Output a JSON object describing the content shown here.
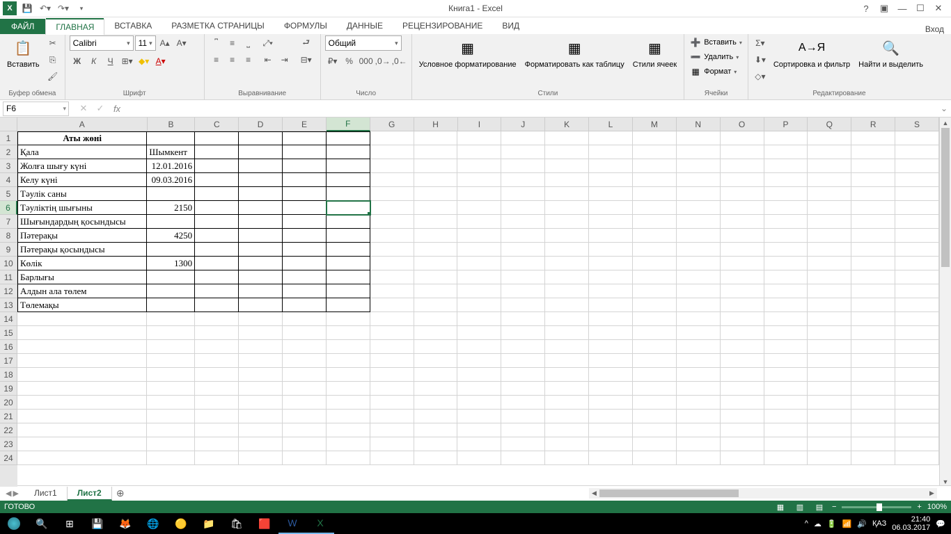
{
  "titlebar": {
    "title": "Книга1 - Excel"
  },
  "tabs": {
    "file": "ФАЙЛ",
    "items": [
      "ГЛАВНАЯ",
      "ВСТАВКА",
      "РАЗМЕТКА СТРАНИЦЫ",
      "ФОРМУЛЫ",
      "ДАННЫЕ",
      "РЕЦЕНЗИРОВАНИЕ",
      "ВИД"
    ],
    "active": 0,
    "signin": "Вход"
  },
  "ribbon": {
    "clipboard": {
      "paste": "Вставить",
      "label": "Буфер обмена"
    },
    "font": {
      "name": "Calibri",
      "size": "11",
      "label": "Шрифт"
    },
    "alignment": {
      "label": "Выравнивание"
    },
    "number": {
      "format": "Общий",
      "label": "Число"
    },
    "styles": {
      "cond": "Условное форматирование",
      "table": "Форматировать как таблицу",
      "cell": "Стили ячеек",
      "label": "Стили"
    },
    "cells": {
      "insert": "Вставить",
      "delete": "Удалить",
      "format": "Формат",
      "label": "Ячейки"
    },
    "editing": {
      "sort": "Сортировка и фильтр",
      "find": "Найти и выделить",
      "label": "Редактирование"
    }
  },
  "namebox": "F6",
  "columns": [
    {
      "l": "A",
      "w": 190
    },
    {
      "l": "B",
      "w": 70
    },
    {
      "l": "C",
      "w": 64
    },
    {
      "l": "D",
      "w": 64
    },
    {
      "l": "E",
      "w": 64
    },
    {
      "l": "F",
      "w": 64
    },
    {
      "l": "G",
      "w": 64
    },
    {
      "l": "H",
      "w": 64
    },
    {
      "l": "I",
      "w": 64
    },
    {
      "l": "J",
      "w": 64
    },
    {
      "l": "K",
      "w": 64
    },
    {
      "l": "L",
      "w": 64
    },
    {
      "l": "M",
      "w": 64
    },
    {
      "l": "N",
      "w": 64
    },
    {
      "l": "O",
      "w": 64
    },
    {
      "l": "P",
      "w": 64
    },
    {
      "l": "Q",
      "w": 64
    },
    {
      "l": "R",
      "w": 64
    },
    {
      "l": "S",
      "w": 64
    }
  ],
  "active_col": 5,
  "active_row": 5,
  "row_count": 24,
  "bordered_rows": 13,
  "bordered_cols": 6,
  "cell_data": {
    "0": {
      "0": {
        "v": "Аты жөні",
        "bold": true,
        "align": "center"
      }
    },
    "1": {
      "0": {
        "v": "Қала"
      },
      "1": {
        "v": "Шымкент"
      }
    },
    "2": {
      "0": {
        "v": "Жолға шығу күні"
      },
      "1": {
        "v": "12.01.2016",
        "align": "right"
      }
    },
    "3": {
      "0": {
        "v": "Келу күні"
      },
      "1": {
        "v": "09.03.2016",
        "align": "right"
      }
    },
    "4": {
      "0": {
        "v": "Тәулік саны"
      }
    },
    "5": {
      "0": {
        "v": "Тәуліктің шығыны"
      },
      "1": {
        "v": "2150",
        "align": "right"
      }
    },
    "6": {
      "0": {
        "v": "Шығындардың қосындысы"
      }
    },
    "7": {
      "0": {
        "v": "Пәтерақы"
      },
      "1": {
        "v": "4250",
        "align": "right"
      }
    },
    "8": {
      "0": {
        "v": "Пәтерақы қосындысы"
      }
    },
    "9": {
      "0": {
        "v": "Көлік"
      },
      "1": {
        "v": "1300",
        "align": "right"
      }
    },
    "10": {
      "0": {
        "v": "Барлығы"
      }
    },
    "11": {
      "0": {
        "v": "Алдын ала төлем"
      }
    },
    "12": {
      "0": {
        "v": "Төлемақы"
      }
    }
  },
  "sheets": {
    "tabs": [
      "Лист1",
      "Лист2"
    ],
    "active": 1
  },
  "status": {
    "ready": "ГОТОВО",
    "zoom": "100%"
  },
  "taskbar": {
    "lang": "ҚАЗ",
    "time": "21:40",
    "date": "06.03.2017"
  }
}
